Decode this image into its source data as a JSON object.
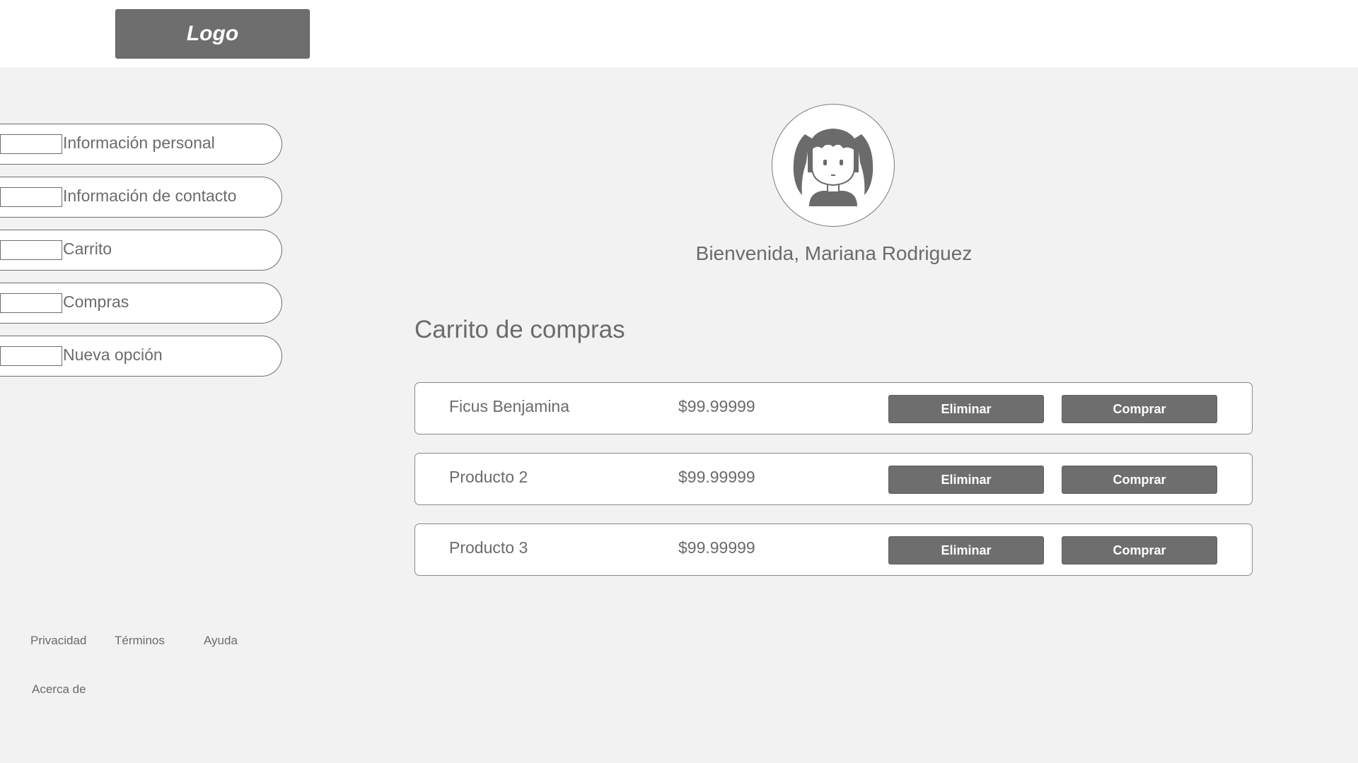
{
  "header": {
    "logo_text": "Logo"
  },
  "sidebar": {
    "items": [
      {
        "label": "Información personal"
      },
      {
        "label": "Información de contacto"
      },
      {
        "label": "Carrito"
      },
      {
        "label": "Compras"
      },
      {
        "label": "Nueva opción"
      }
    ]
  },
  "profile": {
    "avatar_icon": "girl-avatar-icon",
    "welcome_text": "Bienvenida, Mariana Rodriguez"
  },
  "cart": {
    "title": "Carrito de compras",
    "items": [
      {
        "name": "Ficus Benjamina",
        "price": "$99.99999",
        "remove_label": "Eliminar",
        "buy_label": "Comprar"
      },
      {
        "name": "Producto 2",
        "price": "$99.99999",
        "remove_label": "Eliminar",
        "buy_label": "Comprar"
      },
      {
        "name": "Producto 3",
        "price": "$99.99999",
        "remove_label": "Eliminar",
        "buy_label": "Comprar"
      }
    ]
  },
  "footer": {
    "links": [
      "Privacidad",
      "Términos",
      "Ayuda",
      "Acerca de"
    ]
  },
  "colors": {
    "background": "#f2f2f2",
    "button": "#6e6e6e",
    "text": "#6b6b6b"
  }
}
